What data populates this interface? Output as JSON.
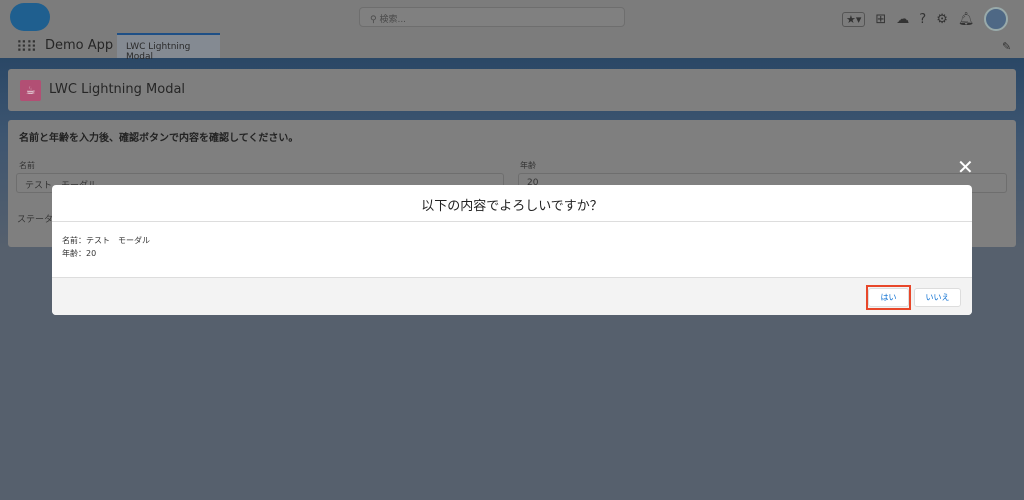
{
  "header": {
    "search_placeholder": "検索...",
    "app_name": "Demo App",
    "tab": "LWC Lightning Modal"
  },
  "page": {
    "title": "LWC Lightning Modal",
    "instruction": "名前と年齢を入力後、確認ボタンで内容を確認してください。",
    "name_label": "名前",
    "name_value": "テスト　モーダル",
    "age_label": "年齢",
    "age_value": "20",
    "status_label": "ステータス"
  },
  "modal": {
    "title": "以下の内容でよろしいですか？",
    "line_name": "名前：テスト　モーダル",
    "line_age": "年齢：20",
    "yes": "はい",
    "no": "いいえ"
  },
  "colors": {
    "highlight": "#e8472a",
    "brand": "#1f5f8f",
    "link": "#0a6ed1"
  }
}
